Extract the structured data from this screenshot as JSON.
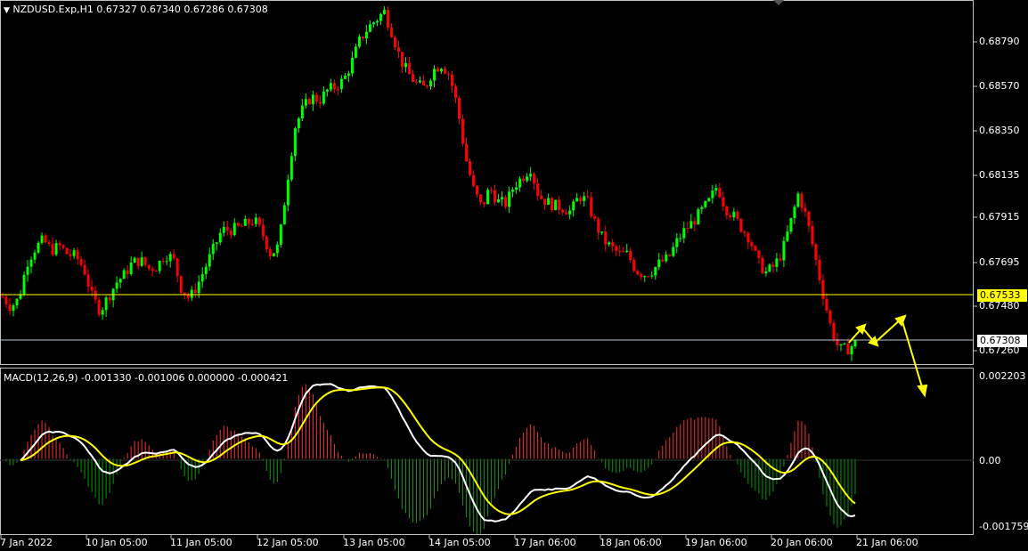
{
  "header": {
    "symbol_info": "NZDUSD.Exp,H1  0.67327 0.67340 0.67286 0.67308",
    "indicator_info": "MACD(12,26,9) -0.001330 -0.001006 0.000000 -0.000421"
  },
  "price_axis": [
    "0.68790",
    "0.68570",
    "0.68350",
    "0.68135",
    "0.67915",
    "0.67695",
    "0.67480",
    "0.67260"
  ],
  "macd_axis": [
    "0.002203",
    "0.00",
    "-0.001759"
  ],
  "time_axis": [
    "7 Jan 2022",
    "10 Jan 05:00",
    "11 Jan 05:00",
    "12 Jan 05:00",
    "13 Jan 05:00",
    "14 Jan 05:00",
    "17 Jan 06:00",
    "18 Jan 06:00",
    "19 Jan 06:00",
    "20 Jan 06:00",
    "21 Jan 06:00"
  ],
  "horizontal_levels": {
    "level_line": "0.67533",
    "bid_line": "0.67308"
  },
  "colors": {
    "bull": "#00ff00",
    "bear": "#ff0000",
    "level": "#ffff00",
    "bid": "#b0c4de",
    "macd_line": "#ffffff",
    "signal_line": "#ffff00",
    "histogram_pos": "#ff3030",
    "histogram_neg": "#00a000"
  },
  "price_path": [
    0.6753,
    0.6748,
    0.6752,
    0.677,
    0.6777,
    0.6781,
    0.6776,
    0.6778,
    0.6774,
    0.6773,
    0.6767,
    0.6753,
    0.6746,
    0.6753,
    0.676,
    0.6764,
    0.677,
    0.6771,
    0.6767,
    0.6768,
    0.6774,
    0.6772,
    0.6757,
    0.6752,
    0.6759,
    0.6768,
    0.6777,
    0.6786,
    0.6786,
    0.6787,
    0.6789,
    0.6791,
    0.6784,
    0.6774,
    0.6778,
    0.6809,
    0.6837,
    0.6846,
    0.6852,
    0.685,
    0.6855,
    0.6857,
    0.686,
    0.6869,
    0.688,
    0.6886,
    0.689,
    0.6894,
    0.6883,
    0.687,
    0.6863,
    0.6858,
    0.6856,
    0.6865,
    0.6868,
    0.6863,
    0.6847,
    0.6822,
    0.6806,
    0.6797,
    0.6807,
    0.68,
    0.6799,
    0.6808,
    0.6812,
    0.6817,
    0.6803,
    0.68,
    0.6798,
    0.6797,
    0.6795,
    0.6803,
    0.68,
    0.6789,
    0.6781,
    0.6777,
    0.6774,
    0.6774,
    0.6766,
    0.6764,
    0.6766,
    0.677,
    0.6772,
    0.678,
    0.6786,
    0.679,
    0.6795,
    0.68,
    0.6808,
    0.6797,
    0.6793,
    0.6787,
    0.6782,
    0.677,
    0.6765,
    0.6768,
    0.6775,
    0.6789,
    0.6804,
    0.6792,
    0.6774,
    0.6755,
    0.6738,
    0.6727,
    0.6727,
    0.673
  ]
}
